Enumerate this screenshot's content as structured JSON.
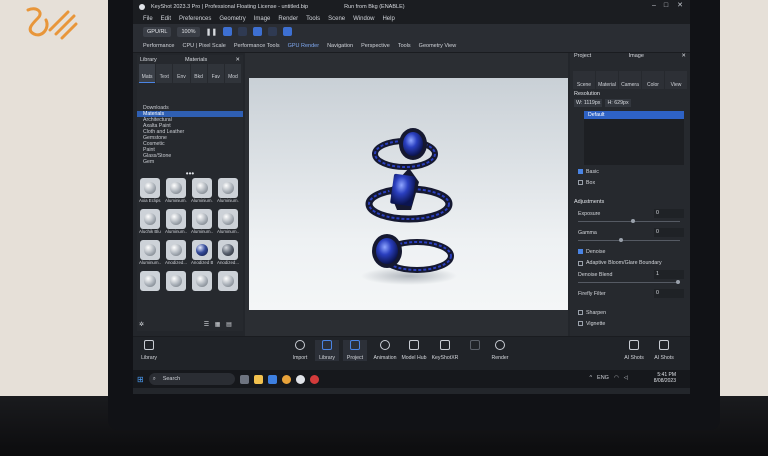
{
  "window": {
    "title": "KeyShot 2023.3 Pro | Professional Floating License - untitled.bip",
    "status": "Run from Bkg (ENABLE)"
  },
  "menu": [
    "File",
    "Edit",
    "Preferences",
    "Geometry",
    "Image",
    "Render",
    "Tools",
    "Scene",
    "Window",
    "Help"
  ],
  "toolbar": {
    "cpu_label": "GPU/RL",
    "zoom": "100%"
  },
  "modes": [
    "Performance",
    "CPU | Pixel Scale",
    "Performance Tools",
    "GPU Render",
    "Navigation",
    "Perspective",
    "Tools",
    "Geometry View"
  ],
  "library": {
    "title": "Library",
    "subtitle": "Materials",
    "tabs": [
      "Mats",
      "Text",
      "Env",
      "Bkd",
      "Fav",
      "Mod"
    ],
    "tree": [
      "Downloads",
      "Materials",
      "Architectural",
      "Axalta Paint",
      "Cloth and Leather",
      "Gemstone",
      "Cosmetic",
      "Paint",
      "Glass/Stone",
      "Gem"
    ],
    "materials": [
      {
        "name": "Axia Eclips...",
        "style": "light"
      },
      {
        "name": "Aluminium...",
        "style": "light"
      },
      {
        "name": "Aluminium...",
        "style": "light"
      },
      {
        "name": "Aluminium...",
        "style": "light"
      },
      {
        "name": "Aluchik Blue...",
        "style": "light"
      },
      {
        "name": "Aluminum...",
        "style": "light"
      },
      {
        "name": "Aluminum...",
        "style": "light"
      },
      {
        "name": "Aluminum...",
        "style": "light"
      },
      {
        "name": "Aluminum...",
        "style": "light"
      },
      {
        "name": "Anodized...",
        "style": "light"
      },
      {
        "name": "Anodized Blue...",
        "style": "navy"
      },
      {
        "name": "Anodized...",
        "style": "dark"
      },
      {
        "name": "",
        "style": "light"
      },
      {
        "name": "",
        "style": "light"
      },
      {
        "name": "",
        "style": "light"
      },
      {
        "name": "",
        "style": "light"
      }
    ]
  },
  "project": {
    "title": "Project",
    "subtitle": "Image",
    "tabs": [
      "Scene",
      "Material",
      "Camera",
      "Color",
      "View"
    ],
    "resolution_label": "Resolution",
    "width": "W: 1119px",
    "height": "H: 629px",
    "camera_list_item": "Default",
    "basic_label": "Basic",
    "box_label": "Box",
    "adjustments": "Adjustments",
    "exposure_label": "Exposure",
    "exposure_value": "0",
    "gamma_label": "Gamma",
    "gamma_value": "0",
    "denoise_label": "Denoise",
    "adaptive_label": "Adaptive Bloom/Glare Boundary",
    "denoise_blend_label": "Denoise Blend",
    "denoise_blend_value": "1",
    "firefly_label": "Firefly Filter",
    "firefly_value": "0",
    "sharpen_label": "Sharpen",
    "vignette_label": "Vignette"
  },
  "ribbon": {
    "left": "Library",
    "items": [
      "Import",
      "Library",
      "Project",
      "Animation",
      "Model Hub",
      "KeyShotXR",
      "",
      "Render"
    ],
    "right": [
      "AI Shots",
      "AI Shots"
    ]
  },
  "taskbar": {
    "search": "Search",
    "lang": "ENG",
    "time": "5:41 PM",
    "date": "8/08/2023"
  },
  "colors": {
    "accent": "#3d6fd1",
    "gem": "#2a3fbf",
    "metal": "#1a1c33"
  }
}
